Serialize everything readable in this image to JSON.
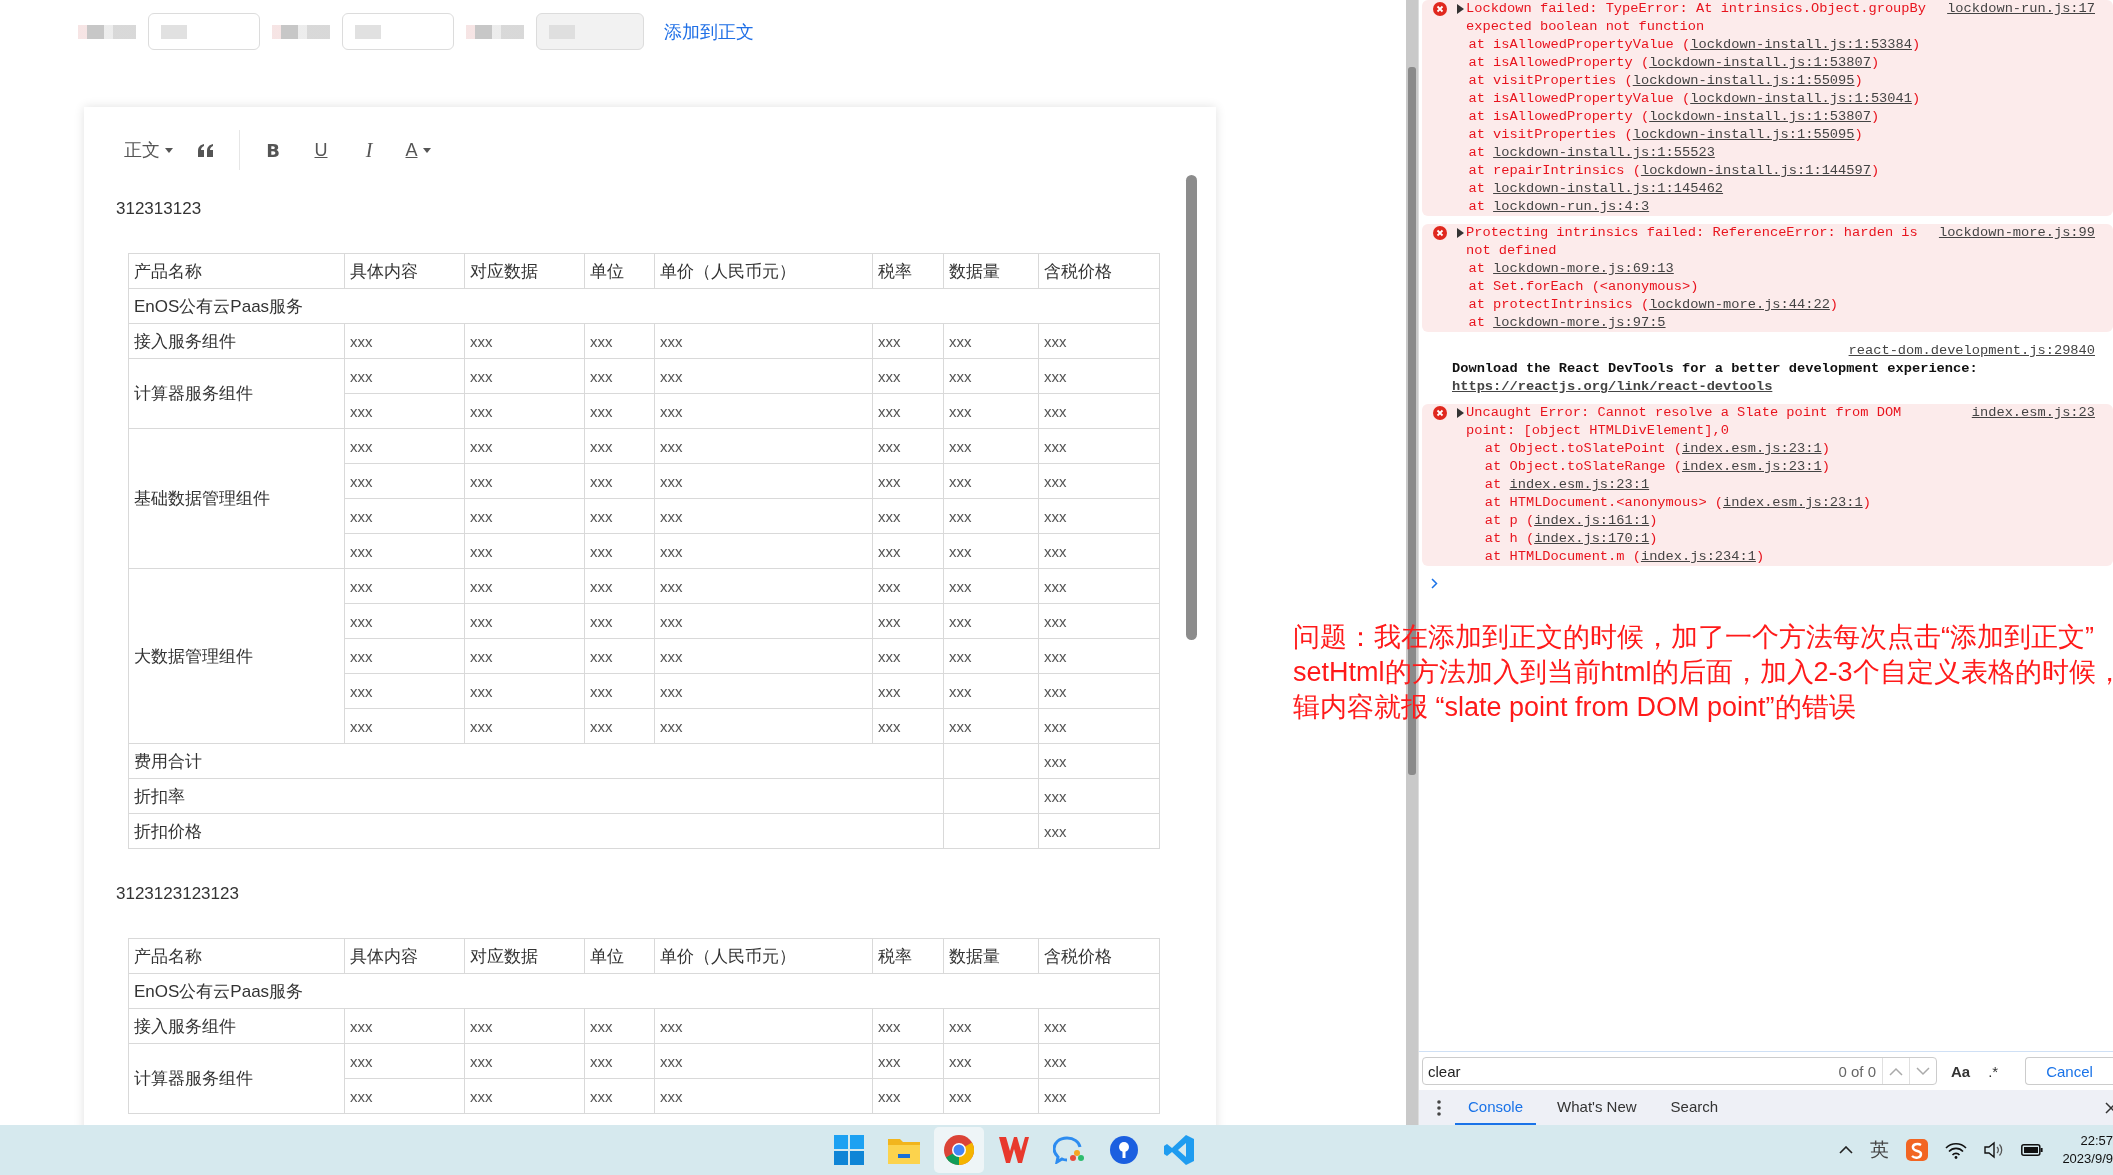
{
  "top_bar": {
    "fields": [
      {
        "disabled": false
      },
      {
        "disabled": false
      },
      {
        "disabled": true
      }
    ],
    "link": "添加到正文"
  },
  "editor": {
    "toolbar": [
      {
        "kind": "dropdown",
        "label": "正文"
      },
      {
        "kind": "quote"
      },
      {
        "kind": "bold",
        "label": "B"
      },
      {
        "kind": "underline",
        "label": "U"
      },
      {
        "kind": "italic",
        "label": "I"
      },
      {
        "kind": "color",
        "label": "A"
      }
    ],
    "content": [
      {
        "kind": "paragraph",
        "text": "312313123"
      },
      {
        "kind": "table",
        "columns": [
          "产品名称",
          "具体内容",
          "对应数据",
          "单位",
          "单价（人民币元）",
          "税率",
          "数据量",
          "含税价格"
        ],
        "section": "EnOS公有云Paas服务",
        "groups": [
          {
            "name": "接入服务组件",
            "rows": [
              [
                "xxx",
                "xxx",
                "xxx",
                "xxx",
                "xxx",
                "xxx",
                "xxx"
              ]
            ]
          },
          {
            "name": "计算器服务组件",
            "rows": [
              [
                "xxx",
                "xxx",
                "xxx",
                "xxx",
                "xxx",
                "xxx",
                "xxx"
              ],
              [
                "xxx",
                "xxx",
                "xxx",
                "xxx",
                "xxx",
                "xxx",
                "xxx"
              ]
            ]
          },
          {
            "name": "基础数据管理组件",
            "rows": [
              [
                "xxx",
                "xxx",
                "xxx",
                "xxx",
                "xxx",
                "xxx",
                "xxx"
              ],
              [
                "xxx",
                "xxx",
                "xxx",
                "xxx",
                "xxx",
                "xxx",
                "xxx"
              ],
              [
                "xxx",
                "xxx",
                "xxx",
                "xxx",
                "xxx",
                "xxx",
                "xxx"
              ],
              [
                "xxx",
                "xxx",
                "xxx",
                "xxx",
                "xxx",
                "xxx",
                "xxx"
              ]
            ]
          },
          {
            "name": "大数据管理组件",
            "rows": [
              [
                "xxx",
                "xxx",
                "xxx",
                "xxx",
                "xxx",
                "xxx",
                "xxx"
              ],
              [
                "xxx",
                "xxx",
                "xxx",
                "xxx",
                "xxx",
                "xxx",
                "xxx"
              ],
              [
                "xxx",
                "xxx",
                "xxx",
                "xxx",
                "xxx",
                "xxx",
                "xxx"
              ],
              [
                "xxx",
                "xxx",
                "xxx",
                "xxx",
                "xxx",
                "xxx",
                "xxx"
              ],
              [
                "xxx",
                "xxx",
                "xxx",
                "xxx",
                "xxx",
                "xxx",
                "xxx"
              ]
            ]
          }
        ],
        "totals": [
          {
            "label": "费用合计",
            "value": "xxx"
          },
          {
            "label": "折扣率",
            "value": "xxx"
          },
          {
            "label": "折扣价格",
            "value": "xxx"
          }
        ]
      },
      {
        "kind": "paragraph",
        "text": "3123123123123"
      },
      {
        "kind": "table",
        "columns": [
          "产品名称",
          "具体内容",
          "对应数据",
          "单位",
          "单价（人民币元）",
          "税率",
          "数据量",
          "含税价格"
        ],
        "section": "EnOS公有云Paas服务",
        "groups": [
          {
            "name": "接入服务组件",
            "rows": [
              [
                "xxx",
                "xxx",
                "xxx",
                "xxx",
                "xxx",
                "xxx",
                "xxx"
              ]
            ]
          },
          {
            "name": "计算器服务组件",
            "rows": [
              [
                "xxx",
                "xxx",
                "xxx",
                "xxx",
                "xxx",
                "xxx",
                "xxx"
              ],
              [
                "xxx",
                "xxx",
                "xxx",
                "xxx",
                "xxx",
                "xxx",
                "xxx"
              ]
            ]
          }
        ]
      }
    ]
  },
  "console": {
    "messages": [
      {
        "kind": "error",
        "text": "Lockdown failed: TypeError: At intrinsics.Object.groupBy expected boolean not function",
        "source": "lockdown-run.js:17",
        "stack": [
          {
            "pre": "  at isAllowedPropertyValue (",
            "link": "lockdown-install.js:1:53384",
            "post": ")"
          },
          {
            "pre": "  at isAllowedProperty (",
            "link": "lockdown-install.js:1:53807",
            "post": ")"
          },
          {
            "pre": "  at visitProperties (",
            "link": "lockdown-install.js:1:55095",
            "post": ")"
          },
          {
            "pre": "  at isAllowedPropertyValue (",
            "link": "lockdown-install.js:1:53041",
            "post": ")"
          },
          {
            "pre": "  at isAllowedProperty (",
            "link": "lockdown-install.js:1:53807",
            "post": ")"
          },
          {
            "pre": "  at visitProperties (",
            "link": "lockdown-install.js:1:55095",
            "post": ")"
          },
          {
            "pre": "  at ",
            "link": "lockdown-install.js:1:55523"
          },
          {
            "pre": "  at repairIntrinsics (",
            "link": "lockdown-install.js:1:144597",
            "post": ")"
          },
          {
            "pre": "  at ",
            "link": "lockdown-install.js:1:145462"
          },
          {
            "pre": "  at ",
            "link": "lockdown-run.js:4:3"
          }
        ]
      },
      {
        "kind": "error",
        "text": "Protecting intrinsics failed: ReferenceError: harden is not defined",
        "source": "lockdown-more.js:99",
        "stack": [
          {
            "pre": "  at ",
            "link": "lockdown-more.js:69:13"
          },
          {
            "pre": "  at Set.forEach (<anonymous>)"
          },
          {
            "pre": "  at protectIntrinsics (",
            "link": "lockdown-more.js:44:22",
            "post": ")"
          },
          {
            "pre": "  at ",
            "link": "lockdown-more.js:97:5"
          }
        ]
      },
      {
        "kind": "log",
        "source": "react-dom.development.js:29840",
        "text": "Download the React DevTools for a better development experience: ",
        "link": "https://reactjs.org/link/react-devtools"
      },
      {
        "kind": "error",
        "text": "Uncaught Error: Cannot resolve a Slate point from DOM point: [object HTMLDivElement],0",
        "source": "index.esm.js:23",
        "stack": [
          {
            "pre": "    at Object.toSlatePoint (",
            "link": "index.esm.js:23:1",
            "post": ")"
          },
          {
            "pre": "    at Object.toSlateRange (",
            "link": "index.esm.js:23:1",
            "post": ")"
          },
          {
            "pre": "    at ",
            "link": "index.esm.js:23:1"
          },
          {
            "pre": "    at HTMLDocument.<anonymous> (",
            "link": "index.esm.js:23:1",
            "post": ")"
          },
          {
            "pre": "    at p (",
            "link": "index.js:161:1",
            "post": ")"
          },
          {
            "pre": "    at h (",
            "link": "index.js:170:1",
            "post": ")"
          },
          {
            "pre": "    at HTMLDocument.m (",
            "link": "index.js:234:1",
            "post": ")"
          }
        ]
      }
    ],
    "search": {
      "value": "clear",
      "count": "0 of 0",
      "case_label": "Aa",
      "regex_label": ".*",
      "cancel": "Cancel"
    },
    "tabs": [
      {
        "label": "Console",
        "selected": true
      },
      {
        "label": "What's New",
        "selected": false
      },
      {
        "label": "Search",
        "selected": false
      }
    ]
  },
  "annotation": {
    "lines": [
      "问题：我在添加到正文的时候，加了一个方法每次点击“添加到正文”",
      "setHtml的方法加入到当前html的后面，加入2-3个自定义表格的时候，",
      "辑内容就报 “slate point from DOM point”的错误"
    ]
  },
  "taskbar": {
    "apps": [
      {
        "kind": "start",
        "selected": false
      },
      {
        "kind": "files",
        "selected": false
      },
      {
        "kind": "browser",
        "selected": true
      },
      {
        "kind": "office",
        "selected": false
      },
      {
        "kind": "chat",
        "selected": false
      },
      {
        "kind": "pin",
        "selected": false
      },
      {
        "kind": "code",
        "selected": false
      }
    ],
    "ime": "英",
    "time": "22:57",
    "date": "2023/9/9"
  }
}
